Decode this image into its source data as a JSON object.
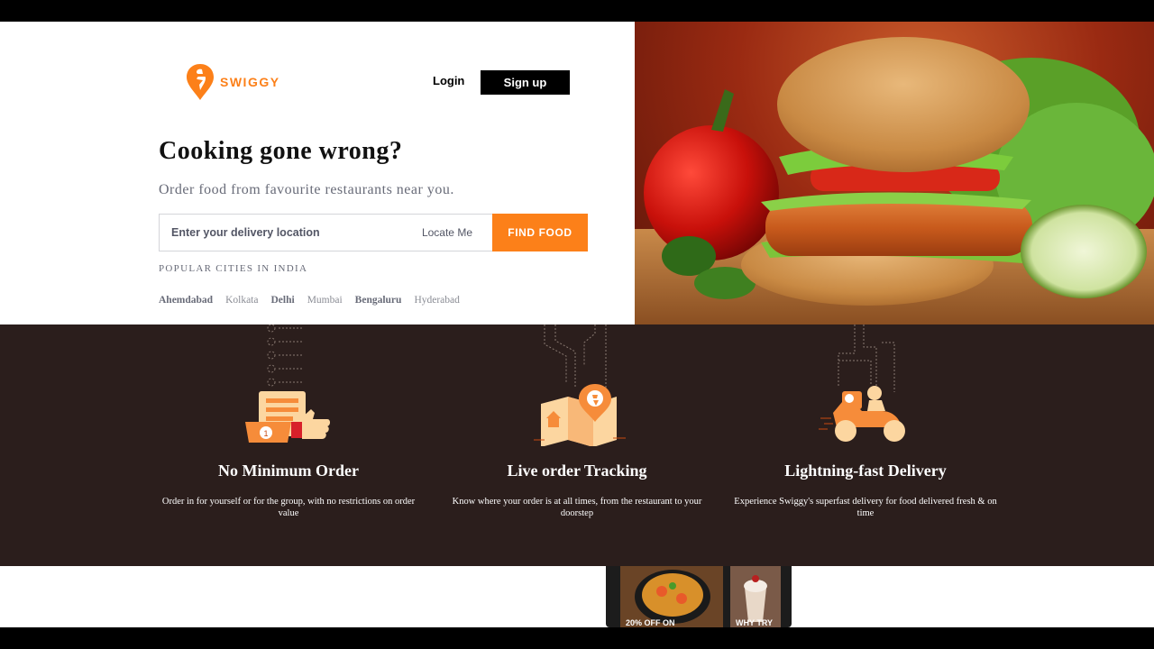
{
  "brand": {
    "name": "SWIGGY",
    "accent": "#fc8019"
  },
  "header": {
    "login_label": "Login",
    "signup_label": "Sign up"
  },
  "hero": {
    "headline": "Cooking gone wrong?",
    "subline": "Order food from favourite restaurants near you.",
    "search": {
      "placeholder": "Enter your delivery location",
      "value": ""
    },
    "locate_label": "Locate Me",
    "find_label": "FIND FOOD",
    "popular_title": "POPULAR CITIES IN INDIA",
    "cities": [
      {
        "name": "Ahemdabad",
        "bold": true
      },
      {
        "name": "Kolkata",
        "bold": false
      },
      {
        "name": "Delhi",
        "bold": true
      },
      {
        "name": "Mumbai",
        "bold": false
      },
      {
        "name": "Bengaluru",
        "bold": true
      },
      {
        "name": "Hyderabad",
        "bold": false
      }
    ],
    "image_alt": "burger-photo"
  },
  "features": [
    {
      "icon": "order-list-thumbs-up-icon",
      "title": "No Minimum Order",
      "desc": "Order in for yourself or for the group, with no restrictions on order value"
    },
    {
      "icon": "map-location-pin-icon",
      "title": "Live order Tracking",
      "desc": "Know where your order is at all times, from the restaurant to your doorstep"
    },
    {
      "icon": "delivery-scooter-icon",
      "title": "Lightning-fast Delivery",
      "desc": "Experience Swiggy's superfast delivery for food delivered fresh & on time"
    }
  ],
  "app_preview": {
    "promos": [
      {
        "label": "20% OFF ON"
      },
      {
        "label": "WHY TRY"
      }
    ]
  },
  "colors": {
    "band": "#2b1e1c",
    "icon_orange": "#f68c3a",
    "icon_peach": "#fcd6a0"
  }
}
